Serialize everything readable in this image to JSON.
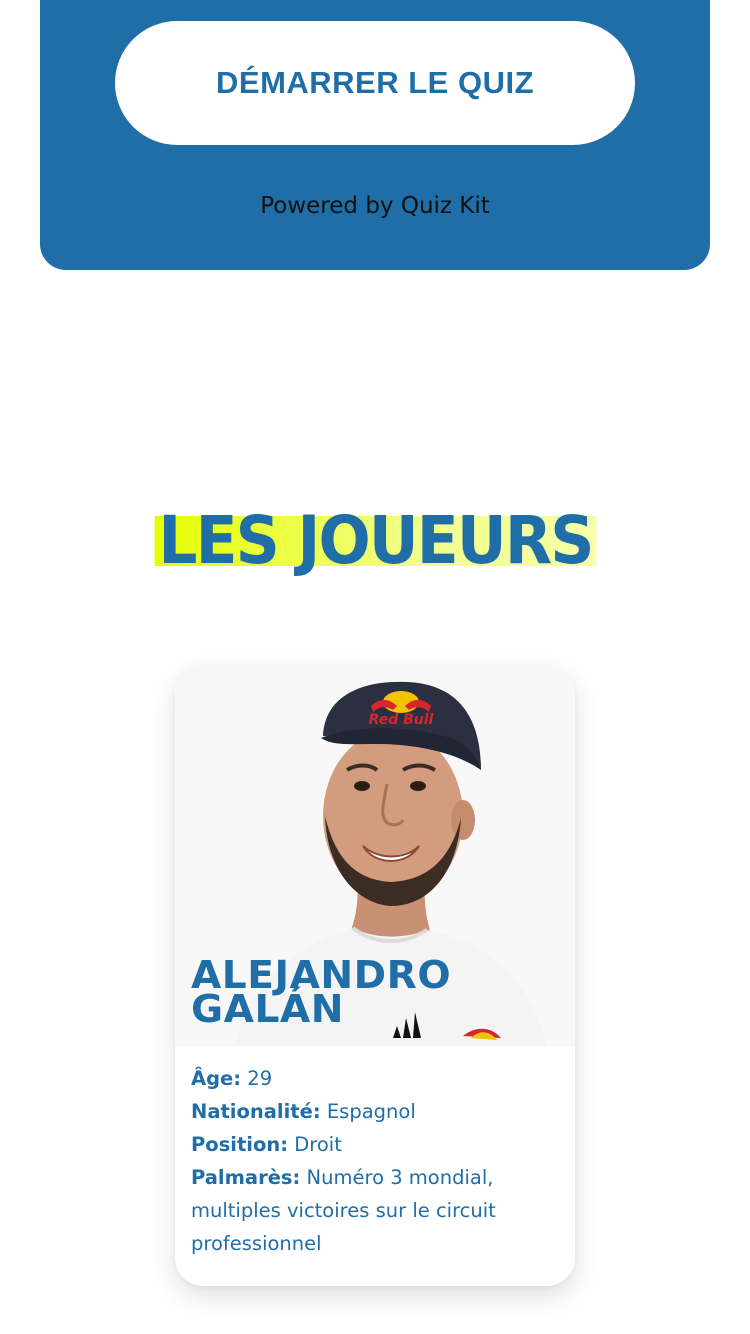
{
  "quiz": {
    "start_button_label": "DÉMARRER LE QUIZ",
    "powered_by": "Powered by Quiz Kit"
  },
  "players_section": {
    "title": "LES JOUEURS"
  },
  "player": {
    "first_name": "ALEJANDRO",
    "last_name": "GALÁN",
    "age_label": "Âge:",
    "age_value": "29",
    "nationality_label": "Nationalité:",
    "nationality_value": "Espagnol",
    "position_label": "Position:",
    "position_value": "Droit",
    "palmares_label": "Palmarès:",
    "palmares_value": "Numéro 3 mondial, multiples victoires sur le circuit professionnel",
    "cap_logo_text": "Red Bull"
  },
  "colors": {
    "brand_blue": "#1f6ea8",
    "highlight_yellow": "#e6ff00",
    "white": "#ffffff"
  }
}
